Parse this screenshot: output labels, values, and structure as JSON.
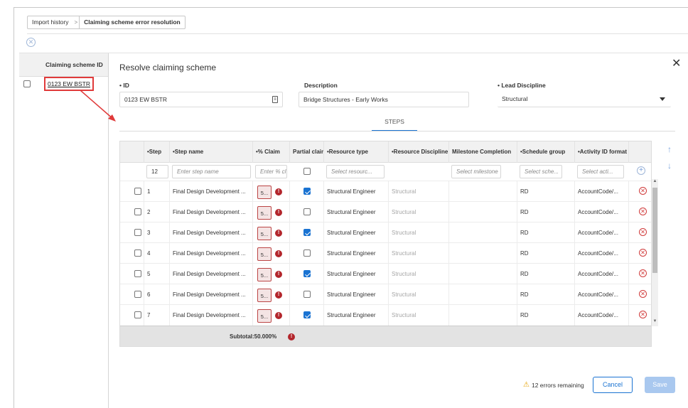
{
  "breadcrumb": {
    "items": [
      "Import history",
      "Claiming scheme error resolution"
    ],
    "separator": ">"
  },
  "left_panel": {
    "header": "Claiming scheme ID",
    "rows": [
      {
        "id": "0123 EW BSTR"
      }
    ]
  },
  "panel": {
    "title": "Resolve claiming scheme",
    "close_glyph": "✕"
  },
  "fields": {
    "id": {
      "label": "• ID",
      "value": "0123 EW BSTR"
    },
    "description": {
      "label": "Description",
      "value": "Bridge Structures - Early Works"
    },
    "lead_discipline": {
      "label": "• Lead Discipline",
      "value": "Structural"
    }
  },
  "tabs": [
    {
      "label": "STEPS",
      "active": true
    }
  ],
  "grid": {
    "columns": [
      "•Step",
      "•Step name",
      "•% Claim",
      "Partial claim",
      "•Resource type",
      "•Resource Discipline",
      "Milestone Completion",
      "•Schedule group",
      "•Activity ID format"
    ],
    "filters": {
      "step": "12",
      "step_name": "Enter step name",
      "claim": "Enter % cl",
      "resource_type": "Select resourc...",
      "milestone": "Select milestone",
      "schedule": "Select sche...",
      "activity": "Select acti..."
    },
    "rows": [
      {
        "step": "1",
        "name": "Final Design Development ...",
        "claim": "5...",
        "partial": true,
        "resource_type": "Structural Engineer",
        "discipline": "Structural",
        "milestone": "",
        "schedule": "RD",
        "activity": "AccountCode/..."
      },
      {
        "step": "2",
        "name": "Final Design Development ...",
        "claim": "5...",
        "partial": false,
        "resource_type": "Structural Engineer",
        "discipline": "Structural",
        "milestone": "",
        "schedule": "RD",
        "activity": "AccountCode/..."
      },
      {
        "step": "3",
        "name": "Final Design Development ...",
        "claim": "5...",
        "partial": true,
        "resource_type": "Structural Engineer",
        "discipline": "Structural",
        "milestone": "",
        "schedule": "RD",
        "activity": "AccountCode/..."
      },
      {
        "step": "4",
        "name": "Final Design Development ...",
        "claim": "5...",
        "partial": false,
        "resource_type": "Structural Engineer",
        "discipline": "Structural",
        "milestone": "",
        "schedule": "RD",
        "activity": "AccountCode/..."
      },
      {
        "step": "5",
        "name": "Final Design Development ...",
        "claim": "5...",
        "partial": true,
        "resource_type": "Structural Engineer",
        "discipline": "Structural",
        "milestone": "",
        "schedule": "RD",
        "activity": "AccountCode/..."
      },
      {
        "step": "6",
        "name": "Final Design Development ...",
        "claim": "5...",
        "partial": false,
        "resource_type": "Structural Engineer",
        "discipline": "Structural",
        "milestone": "",
        "schedule": "RD",
        "activity": "AccountCode/..."
      },
      {
        "step": "7",
        "name": "Final Design Development ...",
        "claim": "5...",
        "partial": true,
        "resource_type": "Structural Engineer",
        "discipline": "Structural",
        "milestone": "",
        "schedule": "RD",
        "activity": "AccountCode/..."
      }
    ],
    "subtotal": "Subtotal:50.000%"
  },
  "footer": {
    "errors_text": "12 errors remaining",
    "cancel": "Cancel",
    "save": "Save"
  },
  "colors": {
    "accent": "#1a73d2",
    "error": "#b3262c",
    "highlight": "#e03a3a",
    "save_disabled": "#a9c8ef"
  }
}
